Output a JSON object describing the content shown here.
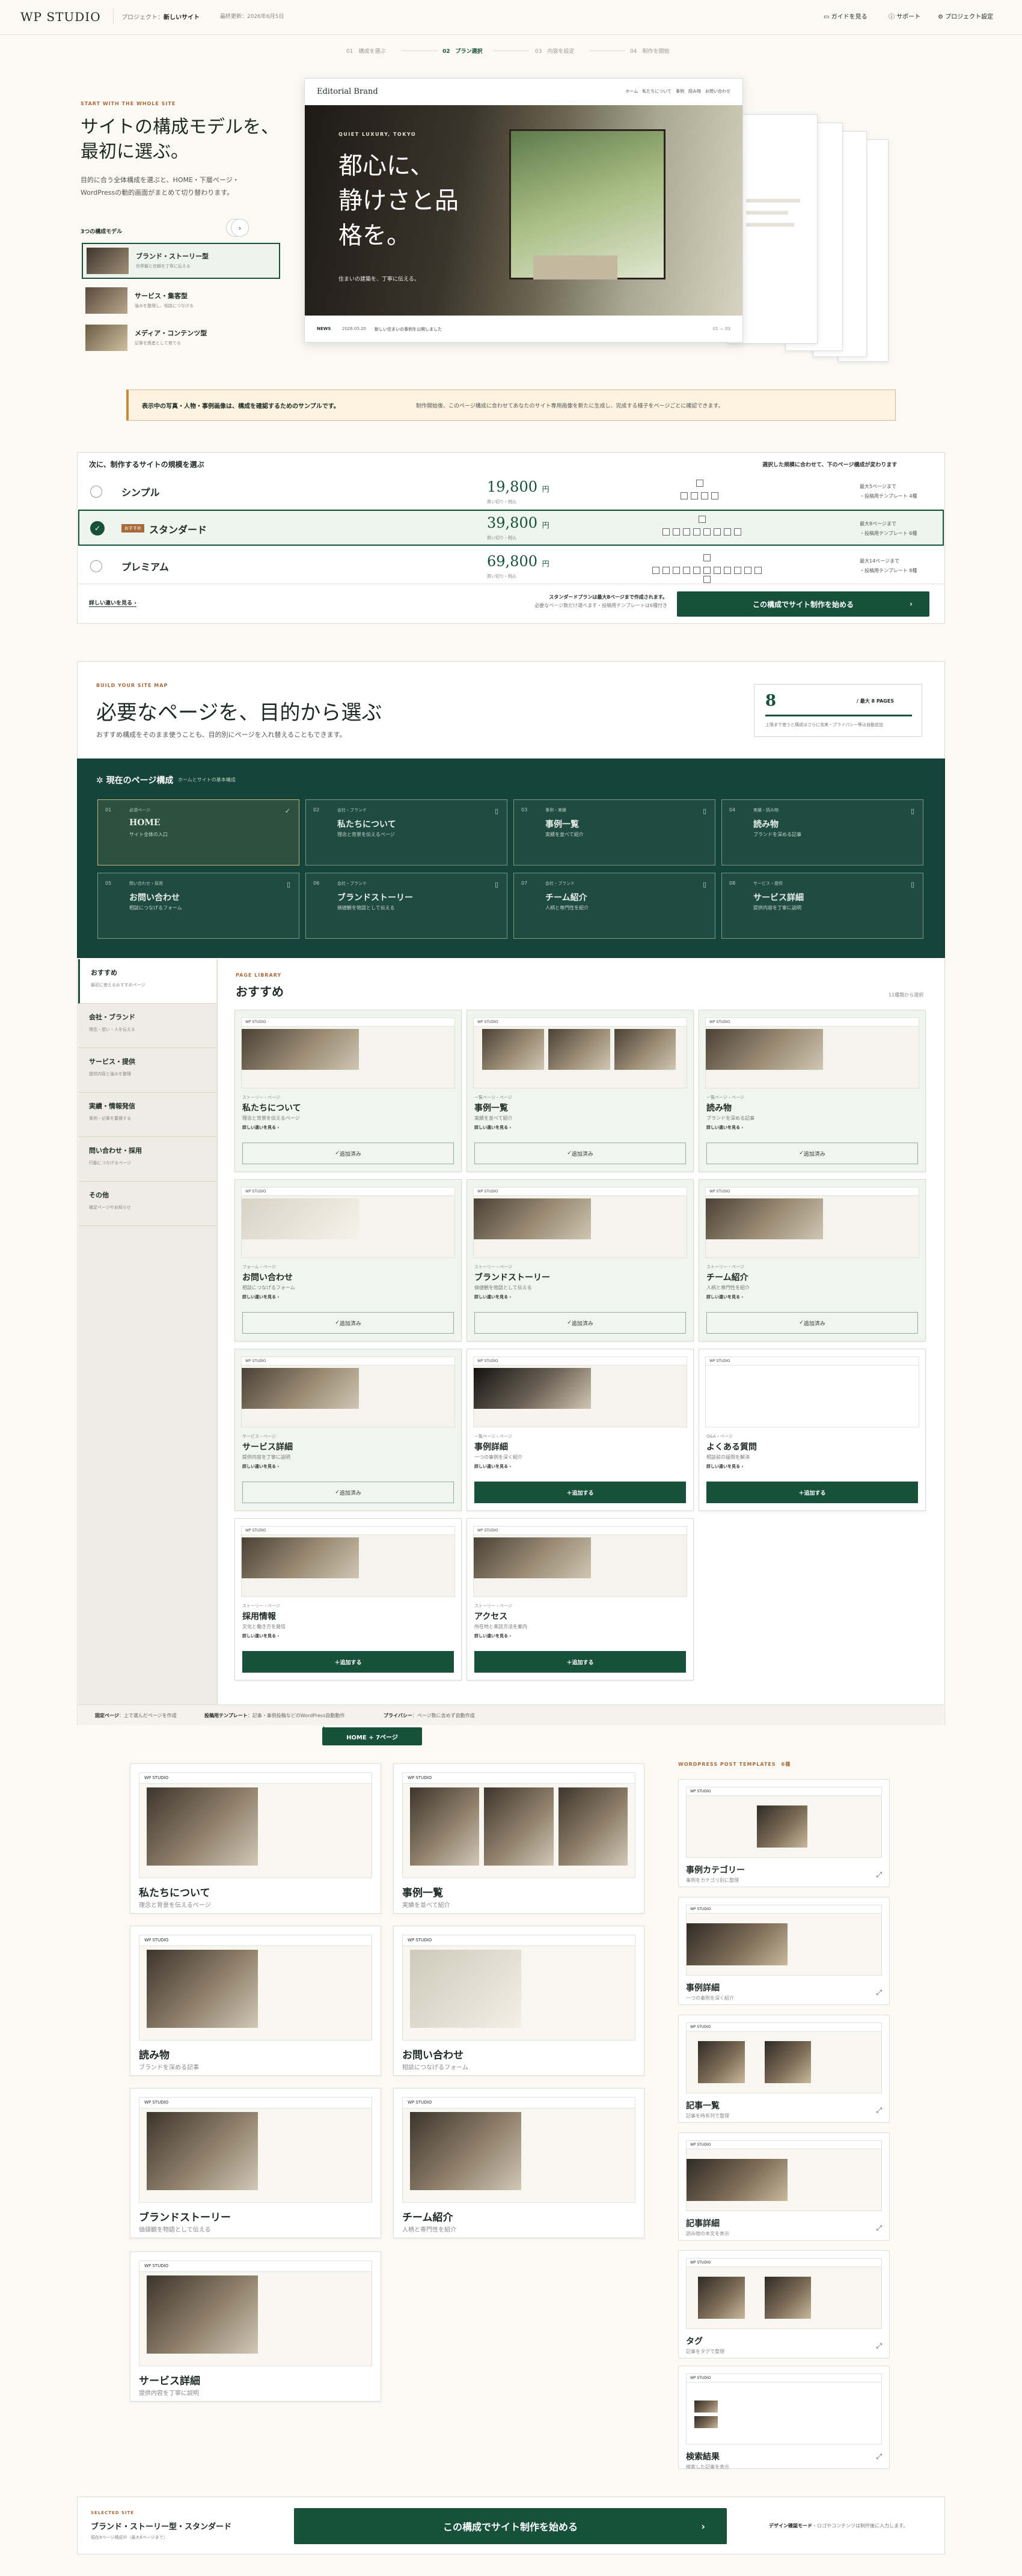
{
  "header": {
    "logo": "WP STUDIO",
    "project_label": "プロジェクト：",
    "project_name": "新しいサイト",
    "last_saved": "最終更新：2026年6月5日",
    "guide": "ガイドを見る",
    "support": "サポート",
    "settings": "プロジェクト設定"
  },
  "steps": [
    {
      "num": "01",
      "label": "構成を選ぶ"
    },
    {
      "num": "02",
      "label": "プラン選択"
    },
    {
      "num": "03",
      "label": "内容を設定"
    },
    {
      "num": "04",
      "label": "制作を開始"
    }
  ],
  "hero": {
    "eyebrow": "START WITH THE WHOLE SITE",
    "title_1": "サイトの構成モデルを、",
    "title_2": "最初に選ぶ。",
    "desc_1": "目的に合う全体構成を選ぶと、HOME・下層ページ・",
    "desc_2": "WordPressの動的画面がまとめて切り替わります。",
    "models_label": "3つの構成モデル",
    "models": [
      {
        "name": "ブランド・ストーリー型",
        "desc": "世界観と信頼を丁寧に伝える"
      },
      {
        "name": "サービス・集客型",
        "desc": "強みを整理し、相談につなげる"
      },
      {
        "name": "メディア・コンテンツ型",
        "desc": "記事を資産として育てる"
      }
    ]
  },
  "preview": {
    "brand": "Editorial Brand",
    "nav": "ホーム　私たちについて　事例　読み物　お問い合わせ",
    "eyebrow": "QUIET LUXURY, TOKYO",
    "headline_1": "都心に、",
    "headline_2": "静けさと品",
    "headline_3": "格を。",
    "sub": "住まいの建築を、丁寧に伝える。",
    "news_label": "NEWS",
    "news_date": "2026.05.20",
    "news_text": "新しい住まいの事例を公開しました",
    "pager": "01 — 03"
  },
  "notice": {
    "bold": "表示中の写真・人物・事例画像は、構成を確認するためのサンプルです。",
    "text": "制作開始後、このページ構成に合わせてあなたのサイト専用画像を新たに生成し、完成する様子をページごとに確認できます。"
  },
  "plan": {
    "title": "次に、制作するサイトの規模を選ぶ",
    "note": "選択した規模に合わせて、下のページ構成が変わります",
    "rows": [
      {
        "name": "シンプル",
        "badge": "",
        "price": "19,800",
        "unit": "円",
        "tax": "買い切り・税込",
        "pages": 5,
        "limit": "最大5ページまで",
        "dyn": "・投稿用テンプレート 4種"
      },
      {
        "name": "スタンダード",
        "badge": "おすすめ",
        "price": "39,800",
        "unit": "円",
        "tax": "買い切り・税込",
        "pages": 9,
        "limit": "最大8ページまで",
        "dyn": "・投稿用テンプレート 6種"
      },
      {
        "name": "プレミアム",
        "badge": "",
        "price": "69,800",
        "unit": "円",
        "tax": "買い切り・税込",
        "pages": 13,
        "limit": "最大14ページまで",
        "dyn": "・投稿用テンプレート 8種"
      }
    ],
    "detail_link": "詳しい違いを見る",
    "cta_note_1": "スタンダードプランは最大8ページまで作成されます。",
    "cta_note_2": "必要なページ数だけ選べます・投稿用テンプレートは6種付き",
    "cta": "この構成でサイト制作を始める"
  },
  "builder": {
    "eyebrow": "BUILD YOUR SITE MAP",
    "title": "必要なページを、目的から選ぶ",
    "desc": "おすすめ構成をそのまま使うことも、目的別にページを入れ替えることもできます。",
    "count": "8",
    "count_total": "/ 最大 8 PAGES",
    "count_note": "上限まで使うと構成はさらに充実・プライバシー等は自動追加",
    "current_title": "現在のページ構成",
    "current_sub": "ホームとサイトの基本構成",
    "current": [
      {
        "n": "01",
        "kind": "必須ページ",
        "title": "HOME",
        "desc": "サイト全体の入口"
      },
      {
        "n": "02",
        "kind": "会社・ブランド",
        "title": "私たちについて",
        "desc": "理念と背景を伝えるページ"
      },
      {
        "n": "03",
        "kind": "事例・実績",
        "title": "事例一覧",
        "desc": "実績を並べて紹介"
      },
      {
        "n": "04",
        "kind": "実績・読み物",
        "title": "読み物",
        "desc": "ブランドを深める記事"
      },
      {
        "n": "05",
        "kind": "問い合わせ・採用",
        "title": "お問い合わせ",
        "desc": "相談につなげるフォーム"
      },
      {
        "n": "06",
        "kind": "会社・ブランド",
        "title": "ブランドストーリー",
        "desc": "価値観を物語として伝える"
      },
      {
        "n": "07",
        "kind": "会社・ブランド",
        "title": "チーム紹介",
        "desc": "人柄と専門性を紹介"
      },
      {
        "n": "08",
        "kind": "サービス・提供",
        "title": "サービス詳細",
        "desc": "提供内容を丁寧に説明"
      }
    ],
    "nav": [
      {
        "label": "おすすめ",
        "sub": "最初に使えるおすすめページ"
      },
      {
        "label": "会社・ブランド",
        "sub": "理念・想い・人を伝える"
      },
      {
        "label": "サービス・提供",
        "sub": "提供内容と強みを整理"
      },
      {
        "label": "実績・情報発信",
        "sub": "事例・記事を蓄積する"
      },
      {
        "label": "問い合わせ・採用",
        "sub": "行動につなげるページ"
      },
      {
        "label": "その他",
        "sub": "補足ページやお知らせ"
      }
    ],
    "lib_eyebrow": "PAGE LIBRARY",
    "lib_title": "おすすめ",
    "lib_count": "11種類から選択",
    "library": [
      {
        "kind": "ストーリー・ページ",
        "title": "私たちについて",
        "desc": "理念と背景を伝えるページ",
        "state": "追加済み"
      },
      {
        "kind": "一覧ページ・ページ",
        "title": "事例一覧",
        "desc": "実績を並べて紹介",
        "state": "追加済み"
      },
      {
        "kind": "一覧ページ・ページ",
        "title": "読み物",
        "desc": "ブランドを深める記事",
        "state": "追加済み"
      },
      {
        "kind": "フォーム・ページ",
        "title": "お問い合わせ",
        "desc": "相談につなげるフォーム",
        "state": "追加済み"
      },
      {
        "kind": "ストーリー・ページ",
        "title": "ブランドストーリー",
        "desc": "価値観を物語として伝える",
        "state": "追加済み"
      },
      {
        "kind": "ストーリー・ページ",
        "title": "チーム紹介",
        "desc": "人柄と専門性を紹介",
        "state": "追加済み"
      },
      {
        "kind": "サービス・ページ",
        "title": "サービス詳細",
        "desc": "提供内容を丁寧に説明",
        "state": "追加済み"
      },
      {
        "kind": "一覧ページ・ページ",
        "title": "事例詳細",
        "desc": "一つの事例を深く紹介",
        "state": "追加する"
      },
      {
        "kind": "Q&A・ページ",
        "title": "よくある質問",
        "desc": "相談前の疑問を解消",
        "state": "追加する"
      },
      {
        "kind": "ストーリー・ページ",
        "title": "採用情報",
        "desc": "文化と働き方を発信",
        "state": "追加する"
      },
      {
        "kind": "ストーリー・ページ",
        "title": "アクセス",
        "desc": "所在地と来訪方法を案内",
        "state": "追加する"
      }
    ],
    "more_label": "詳しい違いを見る",
    "foot_1_b": "固定ページ",
    "foot_1": "上で選んだページを作成",
    "foot_2_b": "投稿用テンプレート",
    "foot_2": "記事・事例投稿などのWordPress自動動作",
    "foot_3_b": "プライバシー",
    "foot_3": "ページ数に含めず自動作成"
  },
  "sitemap": {
    "pill": "HOME + 7ページ",
    "pages": [
      {
        "title": "私たちについて",
        "desc": "理念と背景を伝えるページ"
      },
      {
        "title": "事例一覧",
        "desc": "実績を並べて紹介"
      },
      {
        "title": "読み物",
        "desc": "ブランドを深める記事"
      },
      {
        "title": "お問い合わせ",
        "desc": "相談につなげるフォーム"
      },
      {
        "title": "ブランドストーリー",
        "desc": "価値観を物語として伝える"
      },
      {
        "title": "チーム紹介",
        "desc": "人柄と専門性を紹介"
      },
      {
        "title": "サービス詳細",
        "desc": "提供内容を丁寧に説明"
      }
    ],
    "wp_label": "WORDPRESS POST TEMPLATES",
    "wp_count": "6種",
    "wp": [
      {
        "title": "事例カテゴリー",
        "desc": "事例をカテゴリ別に整理"
      },
      {
        "title": "事例詳細",
        "desc": "一つの事例を深く紹介"
      },
      {
        "title": "記事一覧",
        "desc": "記事を時系列で整理"
      },
      {
        "title": "記事詳細",
        "desc": "読み物の本文を表示"
      },
      {
        "title": "タグ",
        "desc": "記事をタグで整理"
      },
      {
        "title": "検索結果",
        "desc": "検索した記事を表示"
      }
    ]
  },
  "footer": {
    "eyebrow": "SELECTED SITE",
    "title": "ブランド・ストーリー型・スタンダード",
    "sub": "現在8ページ構成中（最大8ページまで）",
    "cta": "この構成でサイト制作を始める",
    "right_b": "デザイン確認モード",
    "right": "・ロゴやコンテンツは制作後に入力します。"
  }
}
